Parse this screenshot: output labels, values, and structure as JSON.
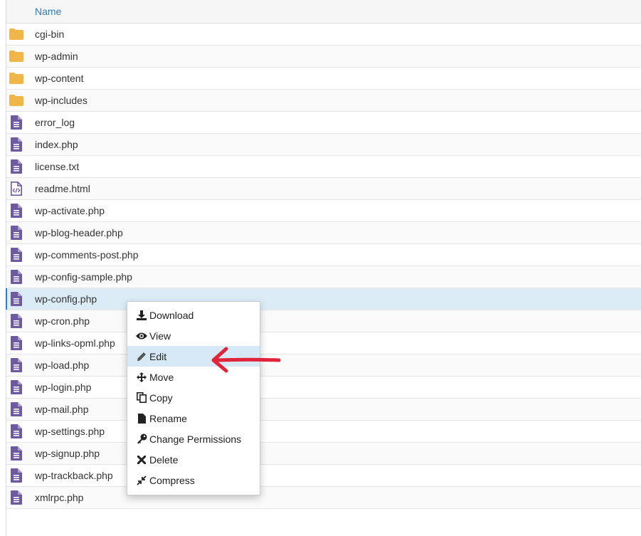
{
  "table": {
    "header": {
      "name_label": "Name"
    },
    "rows": [
      {
        "name": "cgi-bin",
        "icon": "folder-icon",
        "kind": "folder"
      },
      {
        "name": "wp-admin",
        "icon": "folder-icon",
        "kind": "folder"
      },
      {
        "name": "wp-content",
        "icon": "folder-icon",
        "kind": "folder"
      },
      {
        "name": "wp-includes",
        "icon": "folder-icon",
        "kind": "folder"
      },
      {
        "name": "error_log",
        "icon": "file-text-icon",
        "kind": "file"
      },
      {
        "name": "index.php",
        "icon": "file-text-icon",
        "kind": "file"
      },
      {
        "name": "license.txt",
        "icon": "file-text-icon",
        "kind": "file"
      },
      {
        "name": "readme.html",
        "icon": "file-code-icon",
        "kind": "code"
      },
      {
        "name": "wp-activate.php",
        "icon": "file-text-icon",
        "kind": "file"
      },
      {
        "name": "wp-blog-header.php",
        "icon": "file-text-icon",
        "kind": "file"
      },
      {
        "name": "wp-comments-post.php",
        "icon": "file-text-icon",
        "kind": "file"
      },
      {
        "name": "wp-config-sample.php",
        "icon": "file-text-icon",
        "kind": "file"
      },
      {
        "name": "wp-config.php",
        "icon": "file-text-icon",
        "kind": "file",
        "selected": true
      },
      {
        "name": "wp-cron.php",
        "icon": "file-text-icon",
        "kind": "file"
      },
      {
        "name": "wp-links-opml.php",
        "icon": "file-text-icon",
        "kind": "file"
      },
      {
        "name": "wp-load.php",
        "icon": "file-text-icon",
        "kind": "file"
      },
      {
        "name": "wp-login.php",
        "icon": "file-text-icon",
        "kind": "file"
      },
      {
        "name": "wp-mail.php",
        "icon": "file-text-icon",
        "kind": "file"
      },
      {
        "name": "wp-settings.php",
        "icon": "file-text-icon",
        "kind": "file"
      },
      {
        "name": "wp-signup.php",
        "icon": "file-text-icon",
        "kind": "file"
      },
      {
        "name": "wp-trackback.php",
        "icon": "file-text-icon",
        "kind": "file"
      },
      {
        "name": "xmlrpc.php",
        "icon": "file-text-icon",
        "kind": "file"
      }
    ]
  },
  "context_menu": {
    "items": [
      {
        "label": "Download",
        "icon": "download-icon"
      },
      {
        "label": "View",
        "icon": "eye-icon"
      },
      {
        "label": "Edit",
        "icon": "pencil-icon",
        "active": true
      },
      {
        "label": "Move",
        "icon": "move-icon"
      },
      {
        "label": "Copy",
        "icon": "copy-icon"
      },
      {
        "label": "Rename",
        "icon": "file-icon"
      },
      {
        "label": "Change Permissions",
        "icon": "key-icon"
      },
      {
        "label": "Delete",
        "icon": "close-icon"
      },
      {
        "label": "Compress",
        "icon": "compress-icon"
      }
    ]
  },
  "colors": {
    "folder": "#f0b64a",
    "file": "#6e5a9e",
    "header_text": "#337ab7",
    "selected_row": "#dcecf7",
    "menu_active": "#d7e9f7",
    "annotation_arrow": "#e0253a"
  }
}
